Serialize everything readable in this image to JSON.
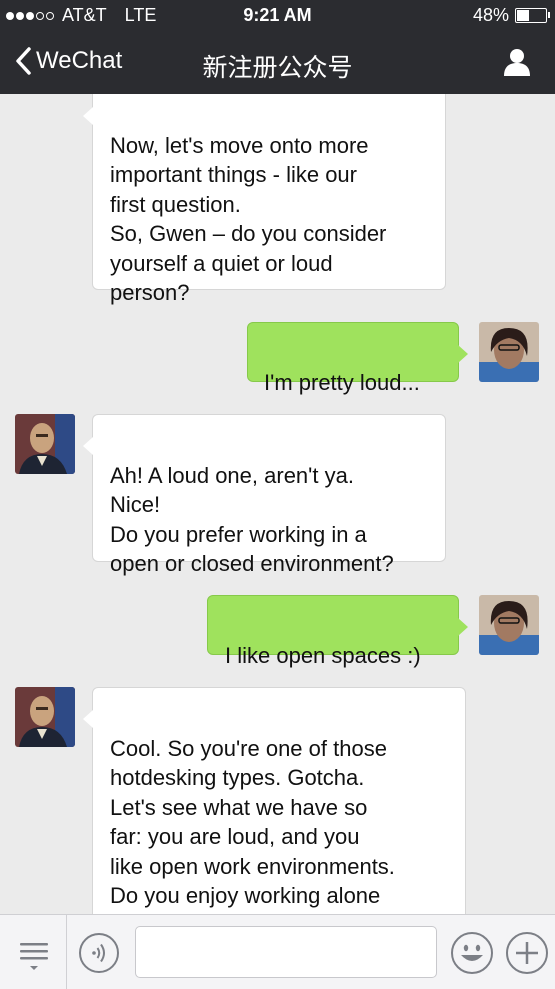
{
  "status_bar": {
    "carrier": "AT&T",
    "network": "LTE",
    "time": "9:21 AM",
    "battery_percent": "48%",
    "battery_level": 0.48,
    "signal_bars_filled": 3,
    "signal_bars_total": 5
  },
  "nav": {
    "back_label": "WeChat",
    "title": "新注册公众号",
    "back_icon": "chevron-left-icon",
    "profile_icon": "person-icon"
  },
  "messages": [
    {
      "sender": "bot",
      "text": "Now, let's move onto more\nimportant things - like our\nfirst question.\n So, Gwen – do you consider\nyourself a quiet or loud\nperson?"
    },
    {
      "sender": "user",
      "text": "I'm pretty loud..."
    },
    {
      "sender": "bot",
      "text": "Ah! A loud one, aren't ya.\nNice!\n Do you prefer working in a\nopen or closed environment?"
    },
    {
      "sender": "user",
      "text": "I like open spaces :)"
    },
    {
      "sender": "bot",
      "text": "Cool. So you're one of those\nhotdesking types. Gotcha.\n Let's see what we have so\nfar: you are loud, and you\nlike open work environments.\nDo you enjoy working alone\nor with people?"
    }
  ],
  "input": {
    "value": "",
    "placeholder": ""
  },
  "toolbar": {
    "menu_icon": "menu-list-icon",
    "voice_icon": "voice-icon",
    "emoji_icon": "emoji-smile-icon",
    "plus_icon": "plus-icon"
  },
  "colors": {
    "header_bg": "#2b2c30",
    "chat_bg": "#ebebeb",
    "outgoing_bubble": "#9fe25d",
    "incoming_bubble": "#ffffff"
  }
}
